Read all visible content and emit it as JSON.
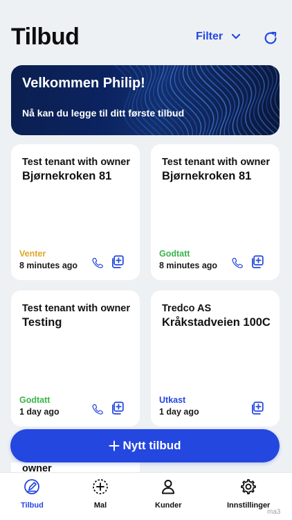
{
  "header": {
    "title": "Tilbud",
    "filter_label": "Filter"
  },
  "banner": {
    "title": "Velkommen Philip!",
    "subtitle": "Nå kan du legge til ditt første tilbud"
  },
  "offers": [
    {
      "tenant": "Test tenant with owner",
      "address": "Bjørnekroken 81",
      "status": "Venter",
      "status_color": "#e0a72a",
      "time": "8 minutes ago",
      "has_phone": true
    },
    {
      "tenant": "Test tenant with owner",
      "address": "Bjørnekroken 81",
      "status": "Godtatt",
      "status_color": "#3bb54a",
      "time": "8 minutes ago",
      "has_phone": true
    },
    {
      "tenant": "Test tenant with owner",
      "address": "Testing",
      "status": "Godtatt",
      "status_color": "#3bb54a",
      "time": "1 day ago",
      "has_phone": true
    },
    {
      "tenant": "Tredco AS",
      "address": "Kråkstadveien 100C",
      "status": "Utkast",
      "status_color": "#2447e0",
      "time": "1 day ago",
      "has_phone": false
    }
  ],
  "partial_card_text": "owner",
  "new_offer_button": {
    "icon": "plus-icon",
    "label": "Nytt tilbud"
  },
  "tabs": [
    {
      "label": "Tilbud",
      "icon": "offer-pen-icon",
      "active": true
    },
    {
      "label": "Mal",
      "icon": "template-plus-icon",
      "active": false
    },
    {
      "label": "Kunder",
      "icon": "person-icon",
      "active": false
    },
    {
      "label": "Innstillinger",
      "icon": "gear-icon",
      "active": false
    }
  ],
  "corner_text": "ma3",
  "colors": {
    "accent": "#2447e0",
    "background": "#eef1f4",
    "banner_dark": "#0b1f4f"
  }
}
